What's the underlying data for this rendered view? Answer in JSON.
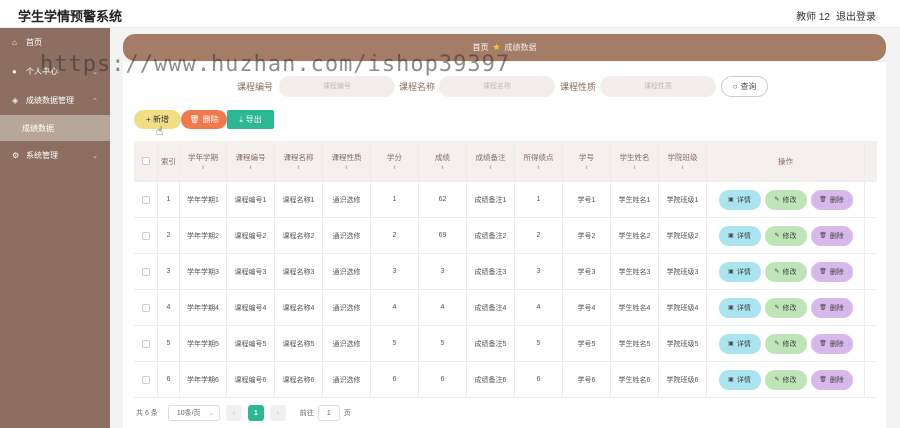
{
  "app": {
    "title": "学生学情预警系统",
    "user": "教师 12",
    "logout": "退出登录"
  },
  "sidebar": {
    "items": [
      {
        "label": "首页",
        "icon": "home-icon"
      },
      {
        "label": "个人中心",
        "icon": "user-icon"
      },
      {
        "label": "成绩数据管理",
        "icon": "data-icon"
      },
      {
        "label": "成绩数据",
        "icon": ""
      },
      {
        "label": "系统管理",
        "icon": "settings-icon"
      }
    ]
  },
  "breadcrumb": {
    "home": "首页",
    "current": "成绩数据"
  },
  "search": {
    "fields": [
      {
        "label": "课程编号",
        "placeholder": "课程编号"
      },
      {
        "label": "课程名称",
        "placeholder": "课程名称"
      },
      {
        "label": "课程性质",
        "placeholder": "课程性质"
      }
    ],
    "button": "查询"
  },
  "toolbar": {
    "add": "+ 新增",
    "delete": "删除",
    "export": "导出"
  },
  "table": {
    "columns": [
      "索引",
      "学年学期",
      "课程编号",
      "课程名称",
      "课程性质",
      "学分",
      "成绩",
      "成绩备注",
      "所得绩点",
      "学号",
      "学生姓名",
      "学院班级",
      "操作"
    ],
    "rows": [
      [
        "1",
        "学年学期1",
        "课程编号1",
        "课程名称1",
        "通识选修",
        "1",
        "62",
        "成绩备注1",
        "1",
        "学号1",
        "学生姓名1",
        "学院班级1"
      ],
      [
        "2",
        "学年学期2",
        "课程编号2",
        "课程名称2",
        "通识选修",
        "2",
        "69",
        "成绩备注2",
        "2",
        "学号2",
        "学生姓名2",
        "学院班级2"
      ],
      [
        "3",
        "学年学期3",
        "课程编号3",
        "课程名称3",
        "通识选修",
        "3",
        "3",
        "成绩备注3",
        "3",
        "学号3",
        "学生姓名3",
        "学院班级3"
      ],
      [
        "4",
        "学年学期4",
        "课程编号4",
        "课程名称4",
        "通识选修",
        "4",
        "4",
        "成绩备注4",
        "4",
        "学号4",
        "学生姓名4",
        "学院班级4"
      ],
      [
        "5",
        "学年学期5",
        "课程编号5",
        "课程名称5",
        "通识选修",
        "5",
        "5",
        "成绩备注5",
        "5",
        "学号5",
        "学生姓名5",
        "学院班级5"
      ],
      [
        "6",
        "学年学期6",
        "课程编号6",
        "课程名称6",
        "通识选修",
        "6",
        "6",
        "成绩备注6",
        "6",
        "学号6",
        "学生姓名6",
        "学院班级6"
      ]
    ],
    "actions": {
      "view": "详情",
      "edit": "修改",
      "delete": "删除"
    }
  },
  "pagination": {
    "total": "共 6 条",
    "page_size": "10条/页",
    "current_page": "1",
    "goto": "前往",
    "goto_value": "1",
    "page_unit": "页"
  },
  "watermark": "https://www.huzhan.com/ishop39397"
}
